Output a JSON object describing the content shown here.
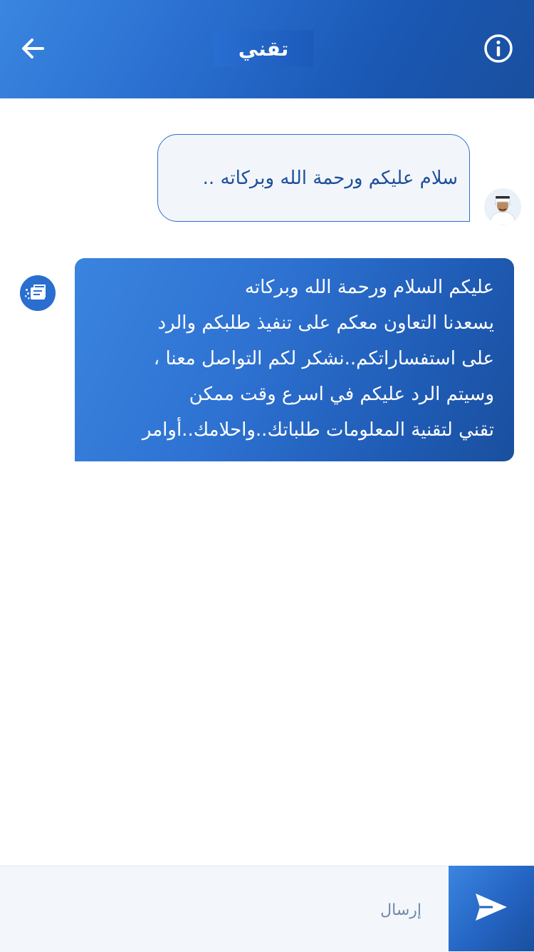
{
  "header": {
    "title": "تقني",
    "back_icon": "arrow-left-icon",
    "info_icon": "info-circle-icon"
  },
  "messages": [
    {
      "sender": "user",
      "text": "سلام عليكم ورحمة الله وبركاته .."
    },
    {
      "sender": "bot",
      "lines": [
        "عليكم السلام ورحمة الله وبركاته",
        "يسعدنا التعاون معكم على تنفيذ طلبكم والرد",
        "على استفساراتكم..نشكر لكم التواصل معنا ،",
        "وسيتم الرد عليكم في اسرع وقت ممكن",
        "تقني لتقنية المعلومات طلباتك..واحلامك..أوامر"
      ]
    }
  ],
  "composer": {
    "placeholder": "إرسال",
    "send_icon": "send-icon"
  },
  "colors": {
    "primary": "#2a6fd0",
    "primary_dark": "#1a4f9e",
    "user_bubble_bg": "#f2f6fb",
    "user_text": "#1e4f9a"
  }
}
